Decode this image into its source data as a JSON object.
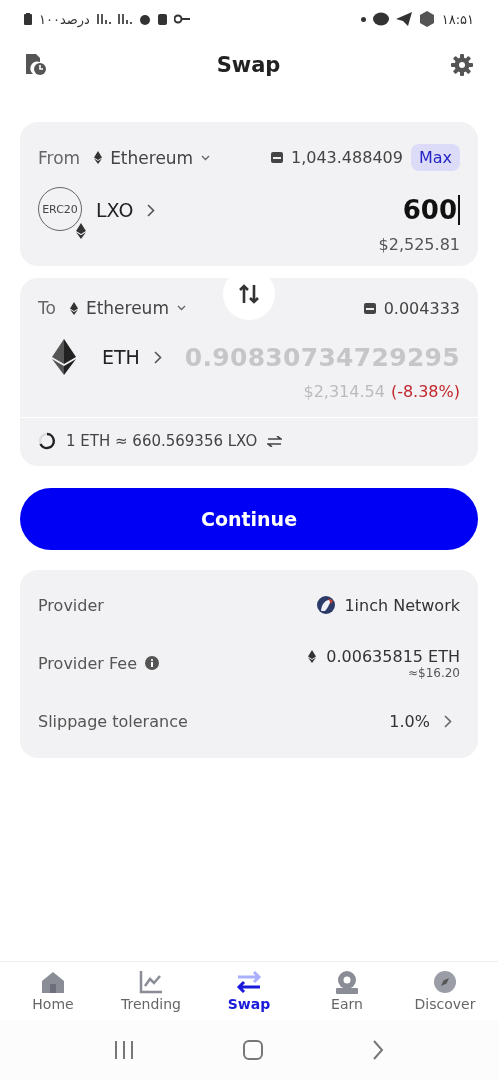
{
  "status_bar": {
    "battery": "۱۰۰درصد",
    "time": "۱۸:۵۱"
  },
  "header": {
    "title": "Swap"
  },
  "from": {
    "label": "From",
    "network": "Ethereum",
    "balance": "1,043.488409",
    "max": "Max",
    "token": "LXO",
    "badge": "ERC20",
    "amount": "600",
    "fiat": "$2,525.81"
  },
  "to": {
    "label": "To",
    "network": "Ethereum",
    "balance": "0.004333",
    "token": "ETH",
    "amount": "0.90830734729295",
    "fiat": "$2,314.54",
    "change": "(-8.38%)",
    "rate": "1 ETH ≈ 660.569356 LXO"
  },
  "continue_button": "Continue",
  "details": [
    {
      "kind": "provider",
      "label": "Provider",
      "value": "1inch Network"
    },
    {
      "kind": "fee",
      "label": "Provider Fee",
      "value": "0.00635815 ETH",
      "sub": "≈$16.20"
    },
    {
      "kind": "slippage",
      "label": "Slippage tolerance",
      "value": "1.0%"
    }
  ],
  "nav": [
    {
      "kind": "home",
      "label": "Home",
      "selected": false
    },
    {
      "kind": "trending",
      "label": "Trending",
      "selected": false
    },
    {
      "kind": "swap",
      "label": "Swap",
      "selected": true
    },
    {
      "kind": "earn",
      "label": "Earn",
      "selected": false
    },
    {
      "kind": "discover",
      "label": "Discover",
      "selected": false
    }
  ]
}
